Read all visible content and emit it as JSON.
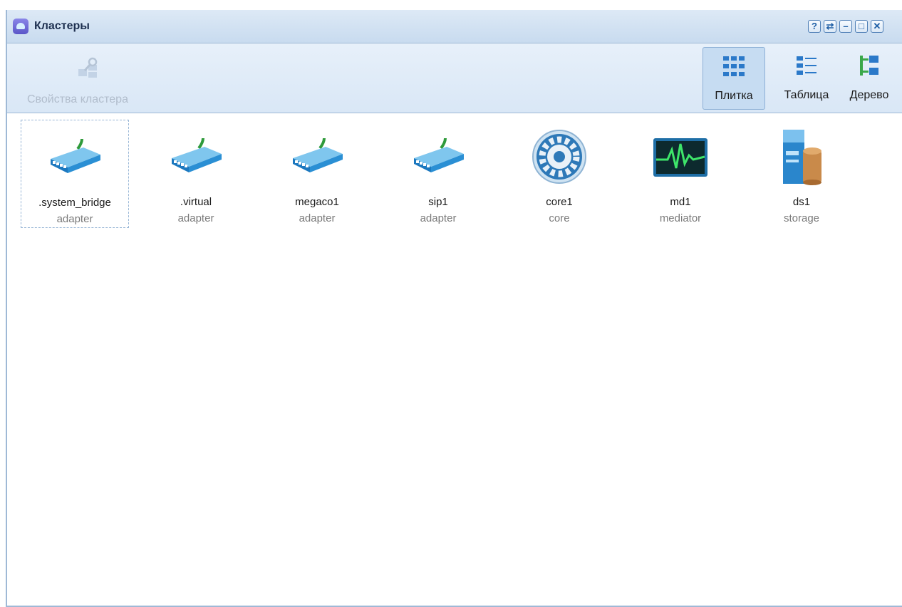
{
  "window": {
    "title": "Кластеры",
    "controls": {
      "help": "?",
      "refresh": "⇄",
      "minimize": "–",
      "maximize": "□",
      "close": "✕"
    }
  },
  "toolbar": {
    "cluster_properties_label": "Свойства кластера",
    "views": [
      {
        "label": "Плитка",
        "icon": "tiles-view-icon",
        "active": true
      },
      {
        "label": "Таблица",
        "icon": "table-view-icon",
        "active": false
      },
      {
        "label": "Дерево",
        "icon": "tree-view-icon",
        "active": false
      }
    ]
  },
  "tiles": [
    {
      "name": ".system_bridge",
      "type": "adapter",
      "icon": "adapter-icon",
      "selected": true
    },
    {
      "name": ".virtual",
      "type": "adapter",
      "icon": "adapter-icon"
    },
    {
      "name": "megaco1",
      "type": "adapter",
      "icon": "adapter-icon"
    },
    {
      "name": "sip1",
      "type": "adapter",
      "icon": "adapter-icon"
    },
    {
      "name": "core1",
      "type": "core",
      "icon": "core-gear-icon"
    },
    {
      "name": "md1",
      "type": "mediator",
      "icon": "mediator-monitor-icon"
    },
    {
      "name": "ds1",
      "type": "storage",
      "icon": "storage-server-icon"
    }
  ],
  "colors": {
    "accent": "#1f5fa6",
    "titlebar": "#c8dbef",
    "selected_view": "#c6dcf2"
  }
}
